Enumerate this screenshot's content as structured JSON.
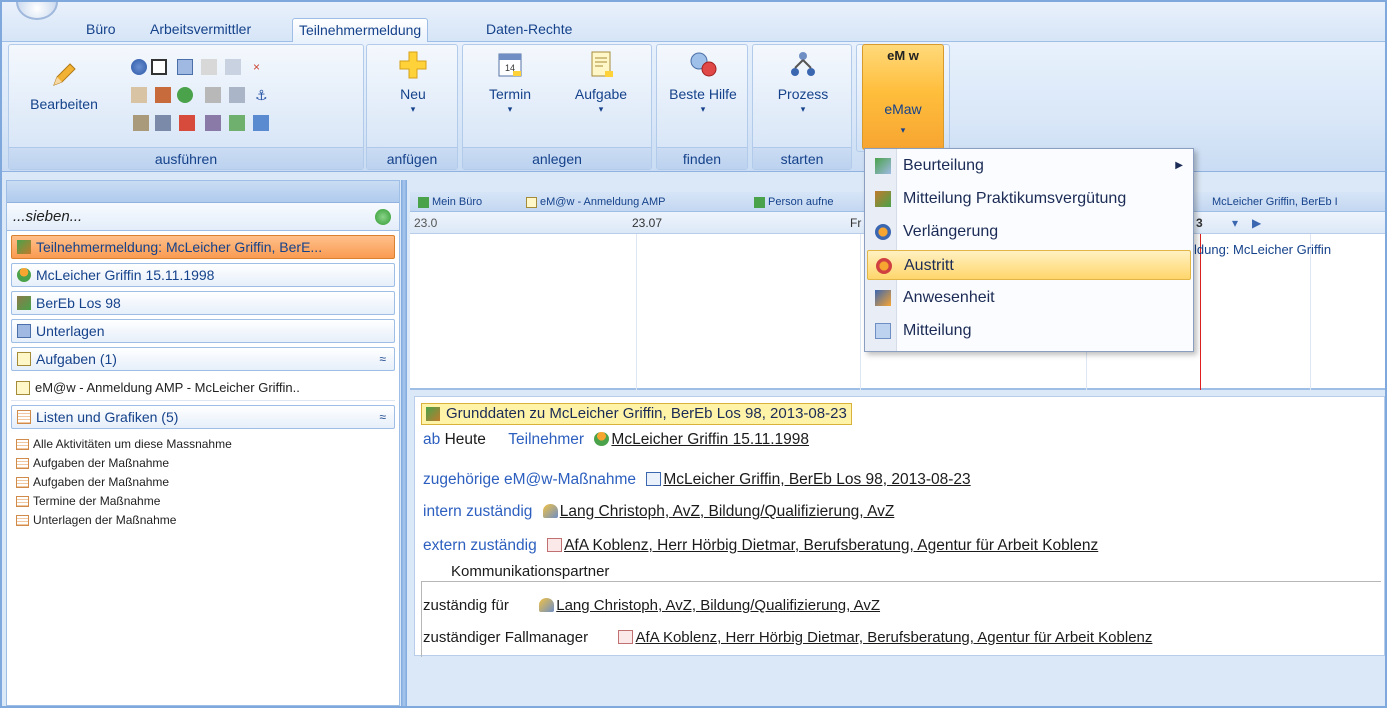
{
  "tabs": [
    "Büro",
    "Arbeitsvermittler",
    "Teilnehmermeldung",
    "Daten-Rechte"
  ],
  "ribbon": {
    "groups": {
      "ausfuehren": "ausführen",
      "anfuegen": "anfügen",
      "anlegen": "anlegen",
      "finden": "finden",
      "starten": "starten"
    },
    "buttons": {
      "bearbeiten": "Bearbeiten",
      "neu": "Neu",
      "termin": "Termin",
      "aufgabe": "Aufgabe",
      "beste_hilfe": "Beste Hilfe",
      "prozess": "Prozess",
      "emaw": "eMaw",
      "emaw_icon_text": "eM w"
    }
  },
  "emaw_menu": {
    "items": [
      {
        "label": "Beurteilung",
        "has_submenu": true
      },
      {
        "label": "Mitteilung Praktikumsvergütung"
      },
      {
        "label": "Verlängerung"
      },
      {
        "label": "Austritt"
      },
      {
        "label": "Anwesenheit"
      },
      {
        "label": "Mitteilung"
      }
    ],
    "hovered": "Austritt"
  },
  "left_panel": {
    "search_placeholder": "...sieben...",
    "items": [
      "Teilnehmermeldung: McLeicher Griffin, BerE...",
      "McLeicher Griffin 15.11.1998",
      "BerEb Los 98",
      "Unterlagen",
      "Aufgaben (1)"
    ],
    "aufgaben_sub": "eM@w - Anmeldung AMP - McLeicher Griffin..",
    "listen_header": "Listen und Grafiken (5)",
    "listen": [
      "Alle Aktivitäten um diese Massnahme",
      "Aufgaben der Maßnahme",
      "Aufgaben der Maßnahme",
      "Termine der Maßnahme",
      "Unterlagen der Maßnahme"
    ]
  },
  "doc_tabs": [
    "Mein Büro",
    "eM@w - Anmeldung AMP",
    "Person aufne",
    "McLeicher Griffin, BerEb I"
  ],
  "calendar": {
    "header_left": "23.0",
    "header_mid": "23.07",
    "header_fr": "Fr",
    "header_num": "3",
    "event": "ldung: McLeicher Griffin"
  },
  "grunddaten": {
    "title": "Grunddaten zu McLeicher Griffin, BerEb Los 98, 2013-08-23",
    "ab": "ab",
    "heute": "Heute",
    "teilnehmer_label": "Teilnehmer",
    "teilnehmer": "McLeicher Griffin 15.11.1998",
    "massnahme_label": "zugehörige eM@w-Maßnahme",
    "massnahme": "McLeicher Griffin, BerEb Los 98, 2013-08-23",
    "intern_label": "intern zuständig",
    "intern": "Lang Christoph, AvZ, Bildung/Qualifizierung, AvZ",
    "extern_label": "extern zuständig",
    "extern": "AfA Koblenz, Herr Hörbig Dietmar, Berufsberatung, Agentur für Arbeit Koblenz",
    "kp_legend": "Kommunikationspartner",
    "zustaendig_fuer_label": "zuständig für",
    "zustaendig_fuer": "Lang Christoph, AvZ, Bildung/Qualifizierung, AvZ",
    "fallmanager_label": "zuständiger Fallmanager",
    "fallmanager": "AfA Koblenz, Herr Hörbig Dietmar, Berufsberatung, Agentur für Arbeit Koblenz"
  }
}
